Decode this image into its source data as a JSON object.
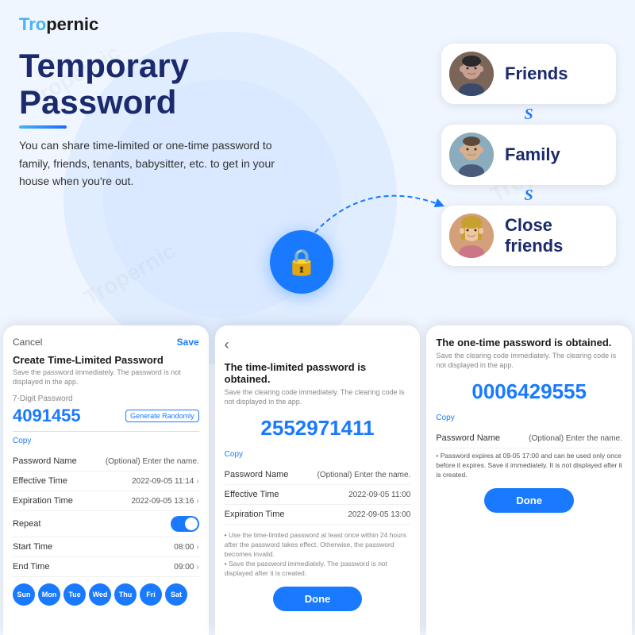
{
  "app": {
    "logo_tro": "Tro",
    "logo_pernic": "pernic"
  },
  "hero": {
    "title_line1": "Temporary",
    "title_line2": "Password",
    "description": "You can share time-limited or one-time password to family, friends, tenants, babysitter, etc. to get in your house when you're out."
  },
  "people": [
    {
      "id": "friends",
      "label": "Friends",
      "avatar_type": "man1"
    },
    {
      "id": "family",
      "label": "Family",
      "avatar_type": "man2"
    },
    {
      "id": "close-friends",
      "label": "Close\nfriends",
      "avatar_type": "woman1"
    }
  ],
  "phone1": {
    "cancel": "Cancel",
    "save": "Save",
    "title": "Create Time-Limited Password",
    "subtitle": "Save the password immediately. The password is not displayed in the app.",
    "field_label": "7-Digit Password",
    "password_value": "4091455",
    "gen_btn": "Generate Randomly",
    "copy": "Copy",
    "rows": [
      {
        "label": "Password Name",
        "value": "(Optional) Enter the name.",
        "type": "text"
      },
      {
        "label": "Effective Time",
        "value": "2022-09-05 11:14",
        "type": "chevron"
      },
      {
        "label": "Expiration Time",
        "value": "2022-09-05 13:16",
        "type": "chevron"
      },
      {
        "label": "Repeat",
        "value": "",
        "type": "toggle"
      },
      {
        "label": "Start Time",
        "value": "08:00",
        "type": "chevron"
      },
      {
        "label": "End Time",
        "value": "09:00",
        "type": "chevron"
      }
    ],
    "days": [
      "Sun",
      "Mon",
      "Tue",
      "Wed",
      "Thu",
      "Fri",
      "Sat"
    ],
    "days_active": [
      0,
      1,
      2,
      3,
      4,
      5,
      6
    ]
  },
  "phone2": {
    "title": "The time-limited password is obtained.",
    "subtitle": "Save the clearing code immediately. The clearing code is not displayed in the app.",
    "password": "2552971411",
    "copy": "Copy",
    "rows": [
      {
        "label": "Password Name",
        "value": "(Optional) Enter the name."
      },
      {
        "label": "Effective Time",
        "value": "2022-09-05 11:00"
      },
      {
        "label": "Expiration Time",
        "value": "2022-09-05 13:00"
      }
    ],
    "notes": [
      "Use the time-limited password at least once within 24 hours after the password takes effect. Otherwise, the password becomes invalid.",
      "Save the password immediately. The password is not displayed after it is created."
    ],
    "done": "Done"
  },
  "phone3": {
    "title": "The one-time password is obtained.",
    "subtitle": "Save the clearing code immediately. The clearing code is not displayed in the app.",
    "password": "0006429555",
    "copy": "Copy",
    "rows": [
      {
        "label": "Password Name",
        "value": "(Optional) Enter the name."
      }
    ],
    "notice": "Password expires at 09-05 17:00 and can be used only once before it expires. Save it immediately. It is not displayed after it is created.",
    "done": "Done"
  }
}
